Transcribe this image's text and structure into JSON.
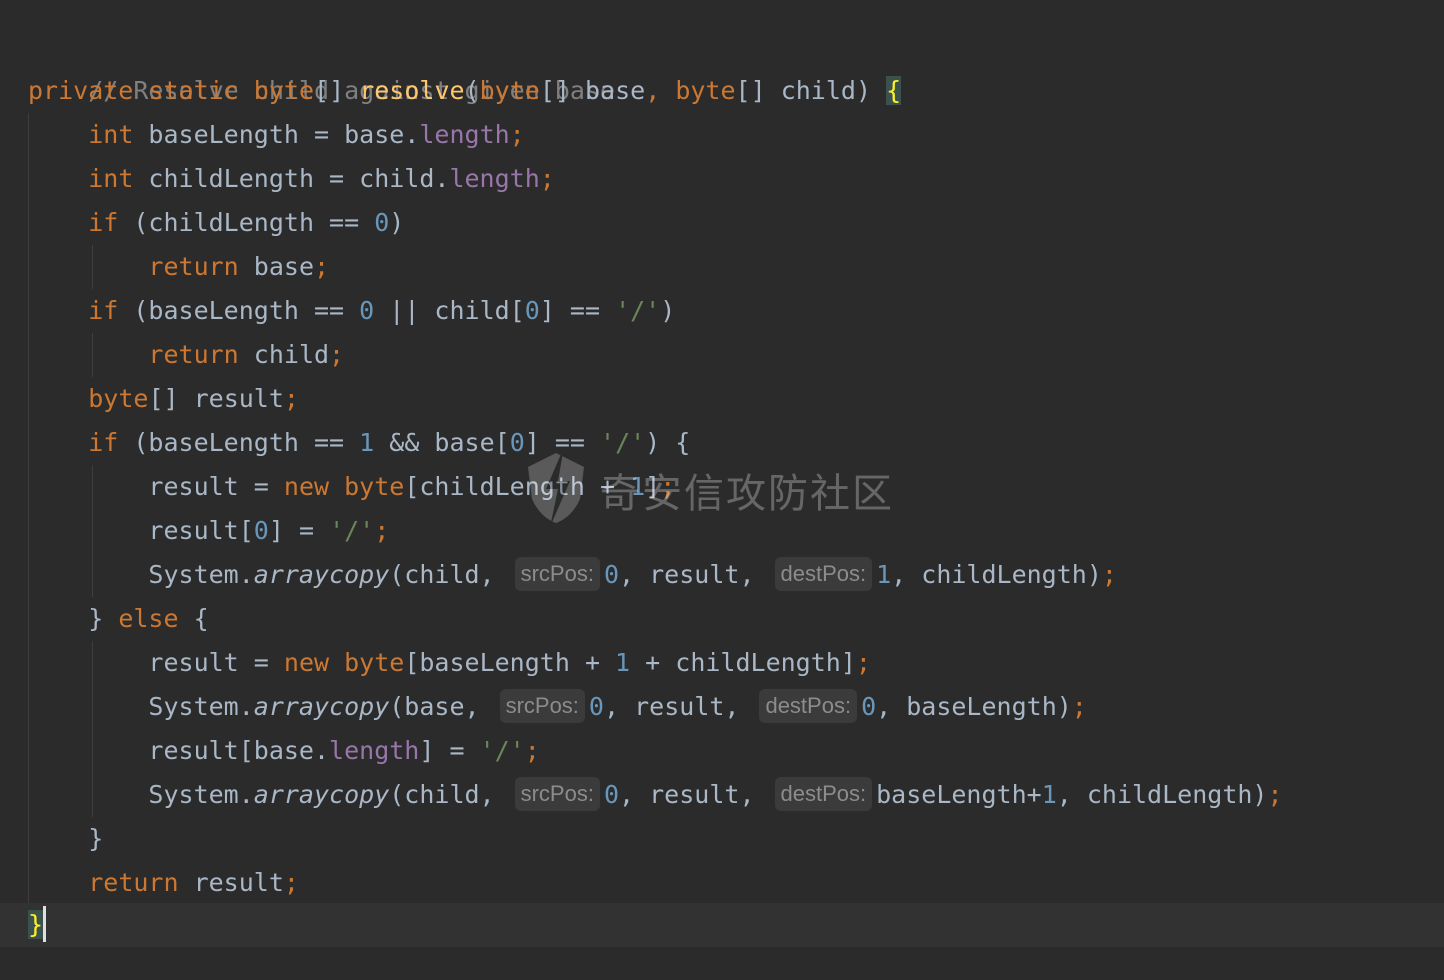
{
  "code": {
    "comment": "// Resolve child against given base",
    "signature": {
      "kw_private": "private",
      "kw_static": "static",
      "type_byte": "byte",
      "brackets": "[]",
      "method_name": "resolve",
      "open_paren": "(",
      "param1_type": "byte",
      "param1_brackets": "[]",
      "param1_name": " base",
      "comma": ", ",
      "param2_type": "byte",
      "param2_brackets": "[]",
      "param2_name": " child",
      "close_paren": ")",
      "open_brace": "{"
    },
    "l3": {
      "kw": "int",
      "text": " baseLength = base.",
      "field": "length",
      "semi": ";"
    },
    "l4": {
      "kw": "int",
      "text": " childLength = child.",
      "field": "length",
      "semi": ";"
    },
    "l5": {
      "kw": "if",
      "text1": " (childLength == ",
      "num": "0",
      "text2": ")"
    },
    "l6": {
      "kw": "return",
      "text": " base",
      "semi": ";"
    },
    "l7": {
      "kw": "if",
      "text1": " (baseLength == ",
      "num1": "0",
      "text2": " || child[",
      "num2": "0",
      "text3": "] == ",
      "str": "'/'",
      "text4": ")"
    },
    "l8": {
      "kw": "return",
      "text": " child",
      "semi": ";"
    },
    "l9": {
      "kw": "byte",
      "text": "[] result",
      "semi": ";"
    },
    "l10": {
      "kw": "if",
      "text1": " (baseLength == ",
      "num1": "1",
      "text2": " && base[",
      "num2": "0",
      "text3": "] == ",
      "str": "'/'",
      "text4": ") {"
    },
    "l11": {
      "text1": "result = ",
      "kw_new": "new",
      "sp": " ",
      "kw_byte": "byte",
      "text2": "[childLength + ",
      "num": "1",
      "text3": "]",
      "semi": ";"
    },
    "l12": {
      "text1": "result[",
      "num": "0",
      "text2": "] = ",
      "str": "'/'",
      "semi": ";"
    },
    "l13": {
      "text1": "System.",
      "method": "arraycopy",
      "text2": "(child,",
      "hint1": "srcPos:",
      "num1": "0",
      "text3": ", result,",
      "hint2": "destPos:",
      "num2": "1",
      "text4": ", childLength)",
      "semi": ";"
    },
    "l14": {
      "text1": "} ",
      "kw": "else",
      "text2": " {"
    },
    "l15": {
      "text1": "result = ",
      "kw_new": "new",
      "sp": " ",
      "kw_byte": "byte",
      "text2": "[baseLength + ",
      "num": "1",
      "text3": " + childLength]",
      "semi": ";"
    },
    "l16": {
      "text1": "System.",
      "method": "arraycopy",
      "text2": "(base,",
      "hint1": "srcPos:",
      "num1": "0",
      "text3": ", result,",
      "hint2": "destPos:",
      "num2": "0",
      "text4": ", baseLength)",
      "semi": ";"
    },
    "l17": {
      "text1": "result[base.",
      "field": "length",
      "text2": "] = ",
      "str": "'/'",
      "semi": ";"
    },
    "l18": {
      "text1": "System.",
      "method": "arraycopy",
      "text2": "(child,",
      "hint1": "srcPos:",
      "num1": "0",
      "text3": ", result,",
      "hint2": "destPos:",
      "text4": "baseLength+",
      "num2": "1",
      "text5": ", childLength)",
      "semi": ";"
    },
    "l19": {
      "text": "}"
    },
    "l20": {
      "kw": "return",
      "text": " result",
      "semi": ";"
    },
    "l21": {
      "text": "}"
    }
  },
  "watermark": {
    "text": "奇安信攻防社区",
    "logo_icon": "shield-bolt-icon"
  },
  "theme": {
    "background": "#2b2b2b",
    "keyword": "#cc7832",
    "function": "#ffc66d",
    "field": "#9876aa",
    "number": "#6897bb",
    "string": "#6a8759",
    "comment": "#808080",
    "text": "#a9b7c6"
  }
}
